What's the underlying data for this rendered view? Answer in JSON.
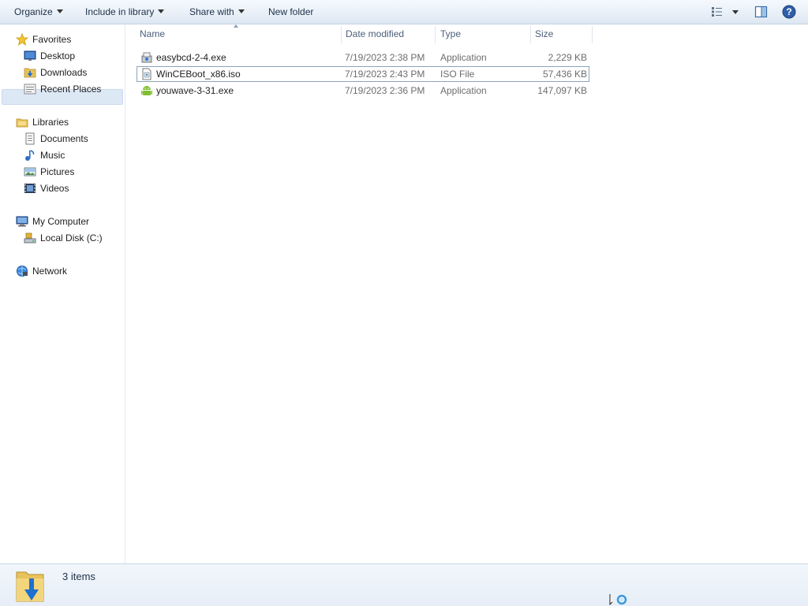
{
  "toolbar": {
    "organize": "Organize",
    "include_in_library": "Include in library",
    "share_with": "Share with",
    "new_folder": "New folder"
  },
  "nav": {
    "favorites": {
      "header": "Favorites",
      "items": [
        {
          "label": "Desktop",
          "icon": "desktop-icon"
        },
        {
          "label": "Downloads",
          "icon": "downloads-folder-icon",
          "selected": true
        },
        {
          "label": "Recent Places",
          "icon": "recent-places-icon"
        }
      ]
    },
    "libraries": {
      "header": "Libraries",
      "items": [
        {
          "label": "Documents",
          "icon": "documents-icon"
        },
        {
          "label": "Music",
          "icon": "music-icon"
        },
        {
          "label": "Pictures",
          "icon": "pictures-icon"
        },
        {
          "label": "Videos",
          "icon": "videos-icon"
        }
      ]
    },
    "computer": {
      "header": "My Computer",
      "items": [
        {
          "label": "Local Disk (C:)",
          "icon": "local-disk-icon"
        }
      ]
    },
    "network": {
      "header": "Network"
    }
  },
  "columns": [
    "Name",
    "Date modified",
    "Type",
    "Size"
  ],
  "files": [
    {
      "name": "easybcd-2-4.exe",
      "date": "7/19/2023 2:38 PM",
      "type": "Application",
      "size": "2,229 KB",
      "icon": "installer-icon"
    },
    {
      "name": "WinCEBoot_x86.iso",
      "date": "7/19/2023 2:43 PM",
      "type": "ISO File",
      "size": "57,436 KB",
      "icon": "iso-file-icon",
      "focused": true
    },
    {
      "name": "youwave-3-31.exe",
      "date": "7/19/2023 2:36 PM",
      "type": "Application",
      "size": "147,097 KB",
      "icon": "android-app-icon"
    }
  ],
  "status": {
    "item_count": "3 items"
  },
  "colors": {
    "toolbar_bg": "#e9f0f8",
    "selection": "#dde8f5",
    "header_text": "#4c607a",
    "secondary_text": "#6d6d6d"
  }
}
